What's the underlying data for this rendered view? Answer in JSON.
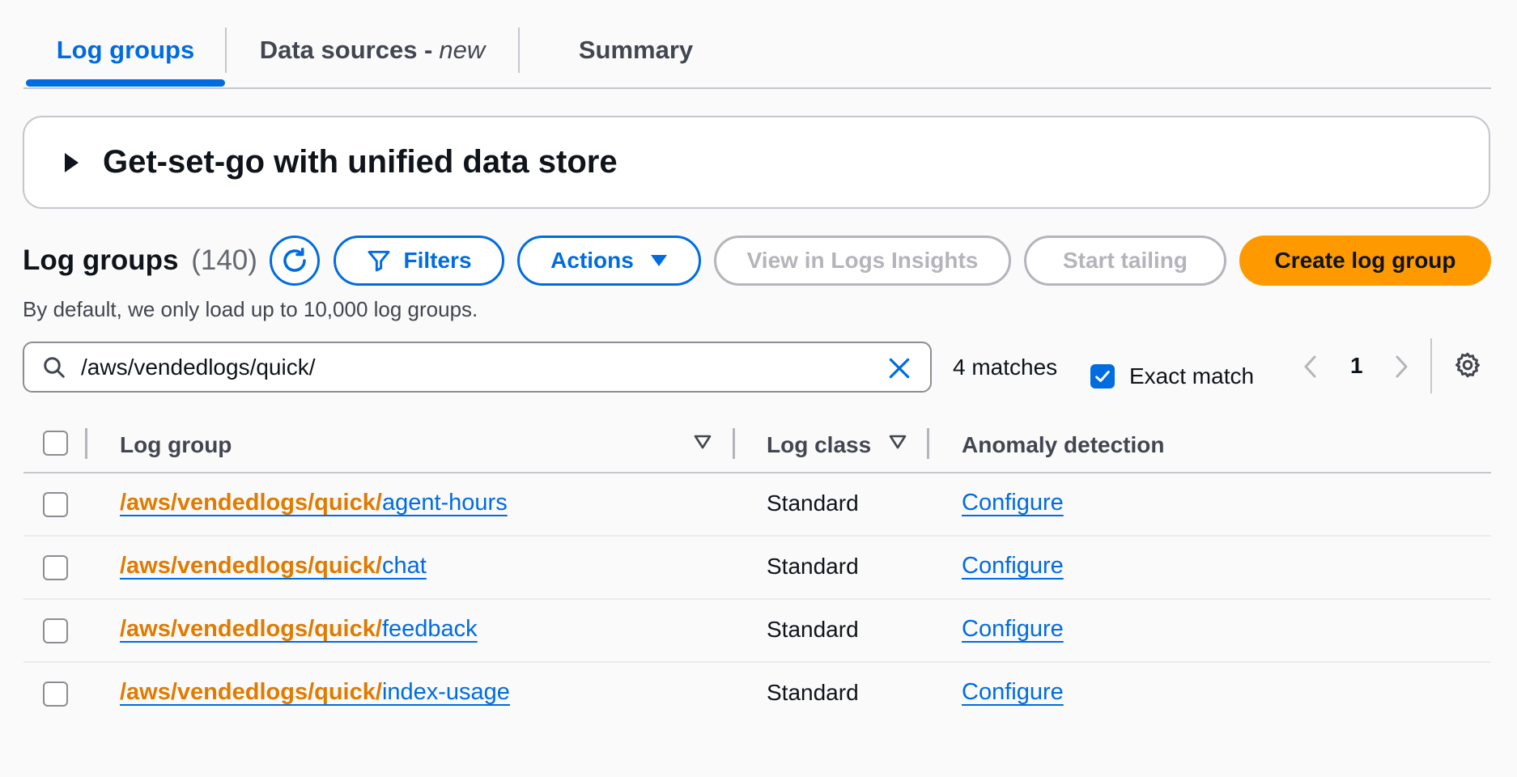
{
  "tabs": [
    {
      "label": "Log groups",
      "suffix": ""
    },
    {
      "label": "Data sources -",
      "suffix": "new"
    },
    {
      "label": "Summary",
      "suffix": ""
    }
  ],
  "panel": {
    "title": "Get-set-go with unified data store"
  },
  "header": {
    "title": "Log groups",
    "count": "(140)",
    "description": "By default, we only load up to 10,000 log groups."
  },
  "toolbar": {
    "filters_label": "Filters",
    "actions_label": "Actions",
    "insights_label": "View in Logs Insights",
    "tailing_label": "Start tailing",
    "create_label": "Create log group"
  },
  "search": {
    "value": "/aws/vendedlogs/quick/",
    "matches": "4 matches",
    "exact_match_label": "Exact match"
  },
  "pagination": {
    "page": "1"
  },
  "table": {
    "columns": [
      "Log group",
      "Log class",
      "Anomaly detection"
    ],
    "rows": [
      {
        "prefix": "/aws/vendedlogs/quick/",
        "suffix": "agent-hours",
        "log_class": "Standard",
        "anomaly": "Configure"
      },
      {
        "prefix": "/aws/vendedlogs/quick/",
        "suffix": "chat",
        "log_class": "Standard",
        "anomaly": "Configure"
      },
      {
        "prefix": "/aws/vendedlogs/quick/",
        "suffix": "feedback",
        "log_class": "Standard",
        "anomaly": "Configure"
      },
      {
        "prefix": "/aws/vendedlogs/quick/",
        "suffix": "index-usage",
        "log_class": "Standard",
        "anomaly": "Configure"
      }
    ]
  },
  "colors": {
    "accent": "#006ce0",
    "primary_button": "#ff9900",
    "highlight_text": "#e07b00",
    "disabled": "#b4b4bb"
  },
  "icons": {
    "refresh": "refresh-icon",
    "filter": "filter-icon",
    "dropdown": "caret-down-icon",
    "search": "search-icon",
    "clear": "close-icon",
    "checkbox_checked": "checkmark-icon",
    "prev": "chevron-left-icon",
    "next": "chevron-right-icon",
    "settings": "gear-icon",
    "sort": "sort-caret-icon",
    "expand": "caret-right-icon"
  }
}
